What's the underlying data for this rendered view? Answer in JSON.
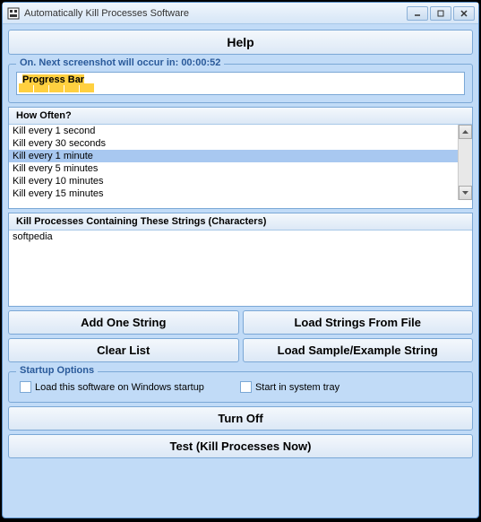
{
  "window": {
    "title": "Automatically Kill Processes Software"
  },
  "help_button": "Help",
  "status_group": {
    "title": "On. Next screenshot will occur in: 00:00:52",
    "progress_label": "Progress Bar"
  },
  "how_often": {
    "header": "How Often?",
    "items": [
      "Kill every 1 second",
      "Kill every 30 seconds",
      "Kill every 1 minute",
      "Kill every 5 minutes",
      "Kill every 10 minutes",
      "Kill every 15 minutes"
    ],
    "selected_index": 2
  },
  "strings_panel": {
    "header": "Kill Processes Containing These Strings (Characters)",
    "items": [
      "softpedia"
    ]
  },
  "buttons": {
    "add_one": "Add One String",
    "load_file": "Load Strings From File",
    "clear": "Clear List",
    "load_sample": "Load Sample/Example String",
    "turn_off": "Turn Off",
    "test": "Test (Kill Processes Now)"
  },
  "startup": {
    "title": "Startup Options",
    "opt1": "Load this software on Windows startup",
    "opt2": "Start in system tray"
  }
}
